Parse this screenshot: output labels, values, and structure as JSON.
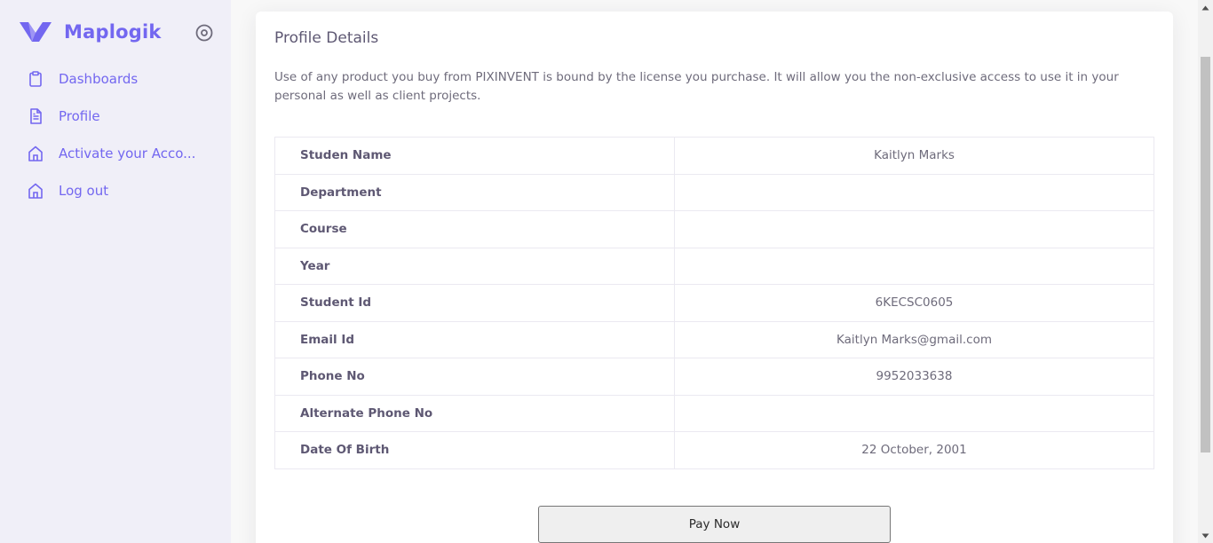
{
  "brand": {
    "name": "Maplogik",
    "accent": "#7367f0"
  },
  "nav": {
    "items": [
      {
        "label": "Dashboards",
        "icon": "clipboard-icon"
      },
      {
        "label": "Profile",
        "icon": "file-text-icon"
      },
      {
        "label": "Activate your Acco...",
        "icon": "home-icon"
      },
      {
        "label": "Log out",
        "icon": "home-icon"
      }
    ]
  },
  "profile": {
    "title": "Profile Details",
    "description": "Use of any product you buy from PIXINVENT is bound by the license you purchase. It will allow you the non-exclusive access to use it in your personal as well as client projects.",
    "rows": [
      {
        "label": "Studen Name",
        "value": "Kaitlyn Marks"
      },
      {
        "label": "Department",
        "value": ""
      },
      {
        "label": "Course",
        "value": ""
      },
      {
        "label": "Year",
        "value": ""
      },
      {
        "label": "Student Id",
        "value": "6KECSC0605"
      },
      {
        "label": "Email Id",
        "value": "Kaitlyn Marks@gmail.com"
      },
      {
        "label": "Phone No",
        "value": "9952033638"
      },
      {
        "label": "Alternate Phone No",
        "value": ""
      },
      {
        "label": "Date Of Birth",
        "value": "22 October, 2001"
      }
    ],
    "pay_label": "Pay Now"
  }
}
